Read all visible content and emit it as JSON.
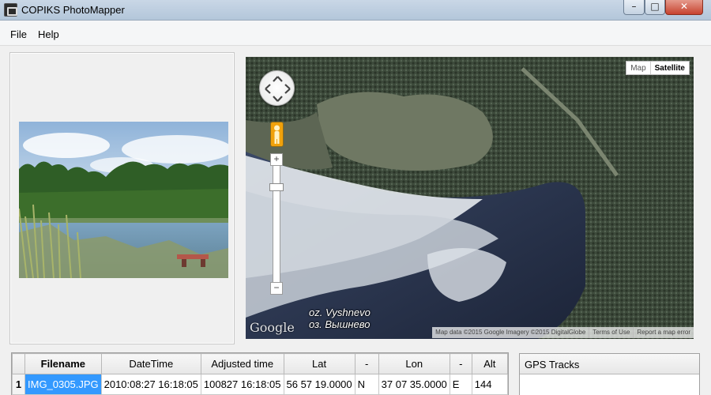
{
  "window": {
    "title": "COPIKS PhotoMapper",
    "controls": {
      "minimize": "–",
      "maximize": "□",
      "close": "✕"
    }
  },
  "menu": {
    "items": [
      "File",
      "Help"
    ]
  },
  "map": {
    "map_type": {
      "map_label": "Map",
      "satellite_label": "Satellite",
      "selected": "Satellite"
    },
    "zoom": {
      "in_label": "+",
      "out_label": "−"
    },
    "place_labels": [
      "oz. Vyshnevo",
      "оз. Вышнево"
    ],
    "logo_text": "Google",
    "footer": [
      "Map data ©2015 Google Imagery ©2015 DigitalGlobe",
      "Terms of Use",
      "Report a map error"
    ]
  },
  "table": {
    "columns": [
      "",
      "Filename",
      "DateTime",
      "Adjusted time",
      "Lat",
      "-",
      "Lon",
      "-",
      "Alt"
    ],
    "rows": [
      [
        "1",
        "IMG_0305.JPG",
        "2010:08:27 16:18:05",
        "100827 16:18:05",
        "56 57 19.0000",
        "N",
        "37 07 35.0000",
        "E",
        "144"
      ]
    ]
  },
  "gps_panel": {
    "title": "GPS Tracks"
  },
  "colors": {
    "selection": "#3399ff",
    "pegman": "#f0a10b"
  }
}
